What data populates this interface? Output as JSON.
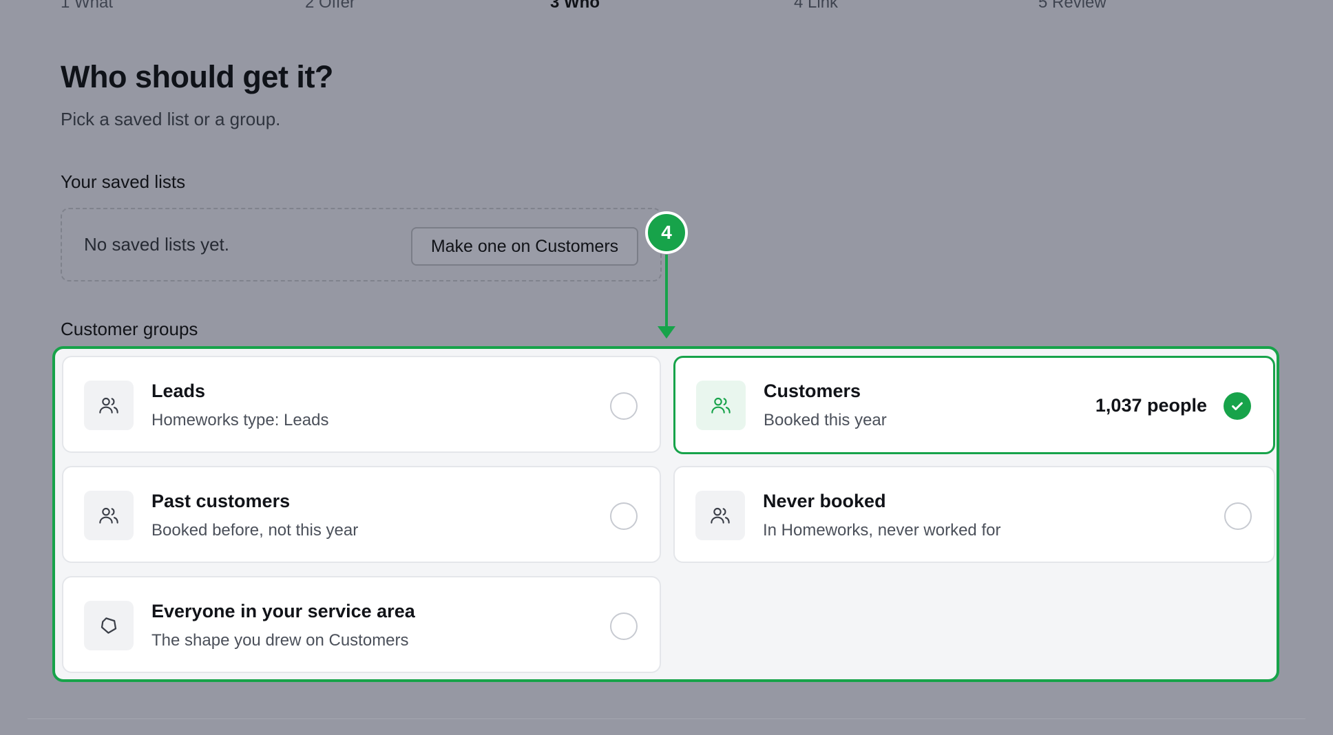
{
  "steps": [
    {
      "label": "1 What",
      "active": false
    },
    {
      "label": "2 Offer",
      "active": false
    },
    {
      "label": "3 Who",
      "active": true
    },
    {
      "label": "4 Link",
      "active": false
    },
    {
      "label": "5 Review",
      "active": false
    }
  ],
  "header": {
    "title": "Who should get it?",
    "subtitle": "Pick a saved list or a group."
  },
  "saved_lists": {
    "label": "Your saved lists",
    "empty_text": "No saved lists yet.",
    "make_button": "Make one on Customers"
  },
  "annotation": {
    "number": "4"
  },
  "groups": {
    "label": "Customer groups",
    "items": [
      {
        "title": "Leads",
        "subtitle": "Homeworks type: Leads",
        "icon": "users-icon",
        "selected": false
      },
      {
        "title": "Customers",
        "subtitle": "Booked this year",
        "icon": "users-icon",
        "selected": true,
        "count": "1,037 people"
      },
      {
        "title": "Past customers",
        "subtitle": "Booked before, not this year",
        "icon": "users-icon",
        "selected": false
      },
      {
        "title": "Never booked",
        "subtitle": "In Homeworks, never worked for",
        "icon": "users-icon",
        "selected": false
      },
      {
        "title": "Everyone in your service area",
        "subtitle": "The shape you drew on Customers",
        "icon": "polygon-icon",
        "selected": false
      }
    ]
  },
  "colors": {
    "accent": "#17a34a",
    "overlay": "#9698a3"
  }
}
